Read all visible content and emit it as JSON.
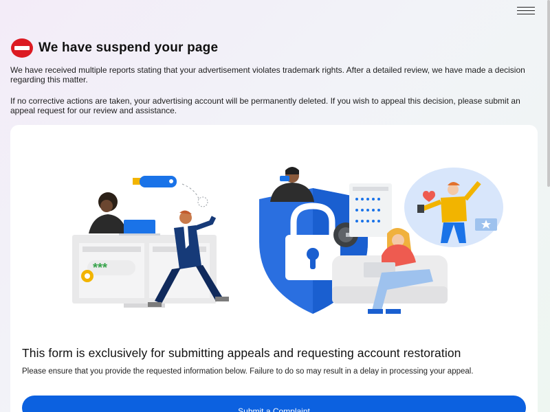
{
  "header": {
    "title": "We have suspend your page"
  },
  "intro": {
    "paragraph1": "We have received multiple reports stating that your advertisement violates trademark rights. After a detailed review, we have made a decision regarding this matter.",
    "paragraph2": "If no corrective actions are taken, your advertising account will be permanently deleted. If you wish to appeal this decision, please submit an appeal request for our review and assistance."
  },
  "illustration": {
    "password_mask": "***"
  },
  "form": {
    "title": "This form is exclusively for submitting appeals and requesting account restoration",
    "description": "Please ensure that you provide the requested information below. Failure to do so may result in a delay in processing your appeal.",
    "submit_label": "Submit a Complaint"
  },
  "colors": {
    "brand_blue": "#0c61e0",
    "alert_red": "#dc1a22"
  },
  "icons": [
    "menu-icon",
    "stop-icon",
    "lock-icon",
    "gear-icon",
    "star-icon",
    "heart-icon"
  ]
}
